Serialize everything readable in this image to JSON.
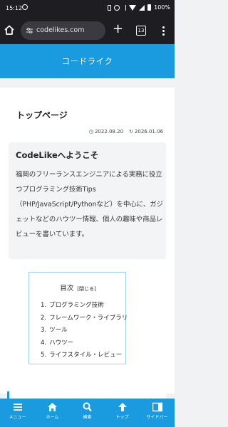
{
  "status_bar": {
    "time": "15:12",
    "battery": "100%"
  },
  "browser": {
    "url": "codelikes.com",
    "tab_count": "13"
  },
  "site": {
    "title": "コードライク"
  },
  "page": {
    "title": "トップページ",
    "published": "2022.08.20",
    "updated": "2026.01.06"
  },
  "intro": {
    "heading": "CodeLikeへようこそ",
    "body": "福岡のフリーランスエンジニアによる実務に役立つプログラミング技術Tips（PHP/JavaScript/Pythonなど）を中心に、ガジェットなどのハウツー情報、個人の趣味や商品レビューを書いています。"
  },
  "toc": {
    "title": "目次",
    "toggle": "[閉じる]",
    "items": [
      {
        "num": "1.",
        "label": "プログラミング技術"
      },
      {
        "num": "2.",
        "label": "フレームワーク・ライブラリ"
      },
      {
        "num": "3.",
        "label": "ツール"
      },
      {
        "num": "4.",
        "label": "ハウツー"
      },
      {
        "num": "5.",
        "label": "ライフスタイル・レビュー"
      }
    ]
  },
  "bottom_nav": [
    {
      "icon": "menu-icon",
      "label": "メニュー"
    },
    {
      "icon": "home-icon",
      "label": "ホーム"
    },
    {
      "icon": "search-icon",
      "label": "検索"
    },
    {
      "icon": "arrow-up-icon",
      "label": "トップ"
    },
    {
      "icon": "sidebar-icon",
      "label": "サイドバー"
    }
  ],
  "colors": {
    "brand": "#1a9be0",
    "toc_border": "#9fcff0",
    "browser_bg": "#1e1e22"
  }
}
